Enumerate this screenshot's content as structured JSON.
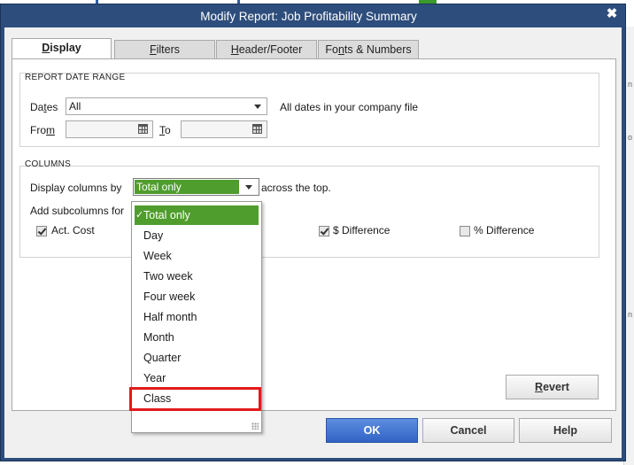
{
  "window": {
    "title": "Modify Report: Job Profitability Summary",
    "close_glyph": "✖"
  },
  "tabs": [
    {
      "label_pre": "",
      "label_u": "D",
      "label_post": "isplay"
    },
    {
      "label_pre": "",
      "label_u": "F",
      "label_post": "ilters"
    },
    {
      "label_pre": "",
      "label_u": "H",
      "label_post": "eader/Footer"
    },
    {
      "label_pre": "Fo",
      "label_u": "n",
      "label_post": "ts & Numbers"
    }
  ],
  "date_range": {
    "group_title": "REPORT DATE RANGE",
    "dates_label_pre": "Da",
    "dates_label_u": "t",
    "dates_label_post": "es",
    "dates_value": "All",
    "dates_description": "All dates in your company file",
    "from_label_pre": "Fro",
    "from_label_u": "m",
    "from_value": "",
    "to_label_u": "T",
    "to_label_post": "o",
    "to_value": ""
  },
  "columns": {
    "group_title": "COLUMNS",
    "display_label": "Display columns by",
    "display_value": "Total only",
    "across_text": "across the top.",
    "subcolumns_label": "Add subcolumns for",
    "subcolumns": [
      {
        "label": "Act. Cost",
        "checked": true
      },
      {
        "label": "$ Difference",
        "checked": true
      },
      {
        "label": "% Difference",
        "checked": false
      }
    ]
  },
  "dropdown": {
    "check_glyph": "✓",
    "options": [
      "Total only",
      "Day",
      "Week",
      "Two week",
      "Four week",
      "Half month",
      "Month",
      "Quarter",
      "Year",
      "Class"
    ],
    "selected": "Total only",
    "highlighted": "Class"
  },
  "buttons": {
    "revert_u": "R",
    "revert_post": "evert",
    "ok": "OK",
    "cancel": "Cancel",
    "help": "Help"
  },
  "background": {
    "strip_text_1": "n",
    "strip_text_2": "o",
    "strip_text_3": "n"
  }
}
